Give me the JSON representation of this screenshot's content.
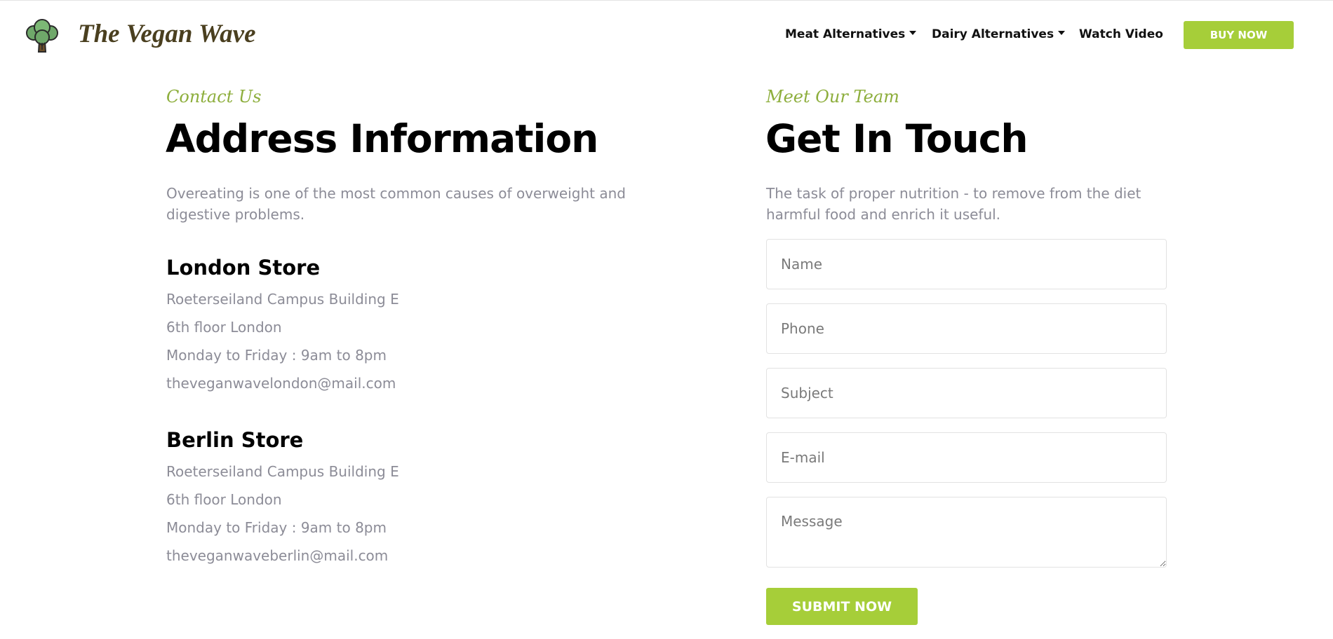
{
  "header": {
    "brand": "The Vegan Wave",
    "nav": {
      "meat": "Meat Alternatives",
      "dairy": "Dairy Alternatives",
      "video": "Watch Video"
    },
    "buy_label": "BUY NOW",
    "colors": {
      "accent": "#a6ce39",
      "brand_text": "#4a3f1f"
    }
  },
  "contact": {
    "eyebrow": "Contact Us",
    "title": "Address Information",
    "lead": "Overeating is one of the most common causes of overweight and digestive problems.",
    "stores": [
      {
        "name": "London Store",
        "line1": "Roeterseiland Campus Building E",
        "line2": "6th floor London",
        "hours": "Monday to Friday : 9am to 8pm",
        "email": "theveganwavelondon@mail.com"
      },
      {
        "name": "Berlin Store",
        "line1": "Roeterseiland Campus Building E",
        "line2": "6th floor London",
        "hours": "Monday to Friday : 9am to 8pm",
        "email": "theveganwaveberlin@mail.com"
      }
    ]
  },
  "touch": {
    "eyebrow": "Meet Our Team",
    "title": "Get In Touch",
    "lead": "The task of proper nutrition - to remove from the diet harmful food and enrich it useful.",
    "form": {
      "name_placeholder": "Name",
      "phone_placeholder": "Phone",
      "subject_placeholder": "Subject",
      "email_placeholder": "E-mail",
      "message_placeholder": "Message",
      "submit_label": "SUBMIT NOW"
    }
  }
}
